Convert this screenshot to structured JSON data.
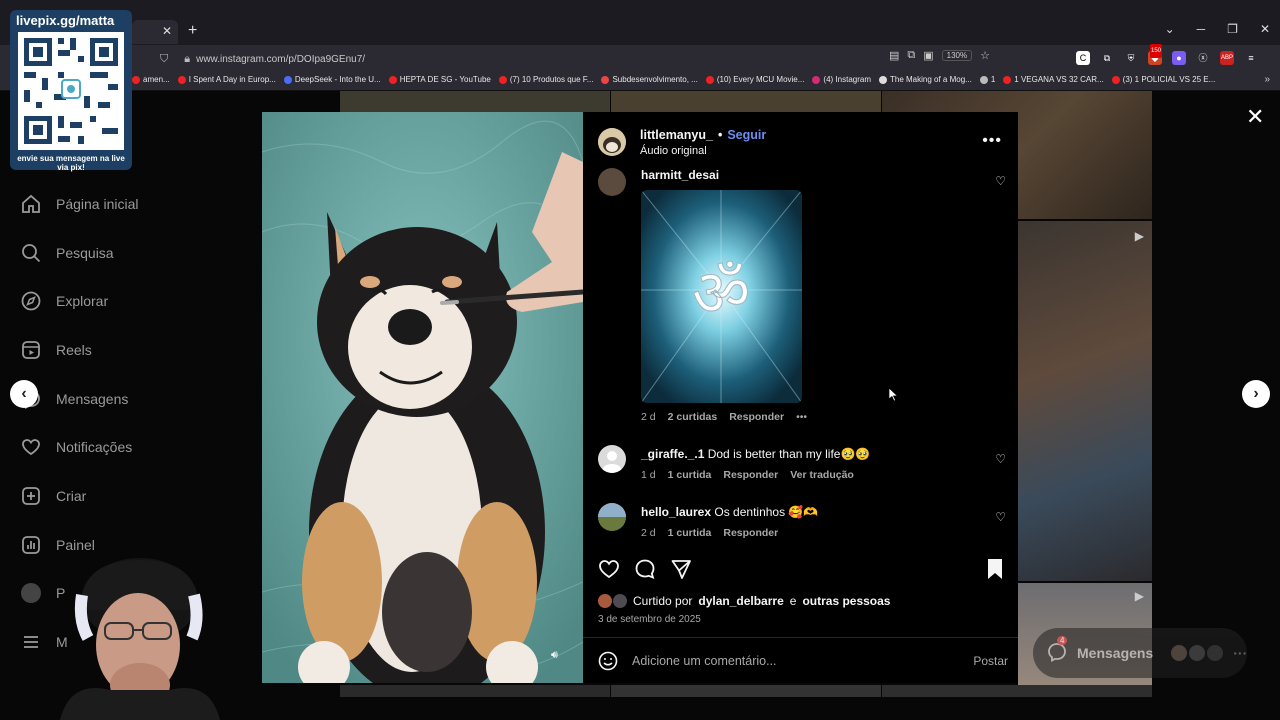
{
  "browser": {
    "url": "www.instagram.com/p/DOIpa9GEnu7/",
    "zoom": "130%",
    "bookmarks": [
      {
        "label": "amen...",
        "color": "#e22"
      },
      {
        "label": "I Spent A Day in Europ...",
        "color": "#e22"
      },
      {
        "label": "DeepSeek - Into the U...",
        "color": "#4a6cf7"
      },
      {
        "label": "HEPTA DE SG - YouTube",
        "color": "#e22"
      },
      {
        "label": "(7) 10 Produtos que F...",
        "color": "#e22"
      },
      {
        "label": "Subdesenvolvimento, ...",
        "color": "#e44"
      },
      {
        "label": "(10) Every MCU Movie...",
        "color": "#e22"
      },
      {
        "label": "(4) Instagram",
        "color": "#d62976"
      },
      {
        "label": "The Making of a Mog...",
        "color": "#ddd"
      },
      {
        "label": "1",
        "color": "#bbb"
      },
      {
        "label": "1 VEGANA VS 32 CAR...",
        "color": "#e22"
      },
      {
        "label": "(3) 1 POLICIAL VS 25 E...",
        "color": "#e22"
      }
    ],
    "ext_badge": "150"
  },
  "overlay": {
    "qr_title": "livepix.gg/matta",
    "qr_caption": "envie sua mensagem na live via pix!"
  },
  "sidebar": {
    "items": [
      {
        "label": "Página inicial",
        "icon": "home-icon"
      },
      {
        "label": "Pesquisa",
        "icon": "search-icon"
      },
      {
        "label": "Explorar",
        "icon": "compass-icon"
      },
      {
        "label": "Reels",
        "icon": "reels-icon"
      },
      {
        "label": "Mensagens",
        "icon": "messenger-icon"
      },
      {
        "label": "Notificações",
        "icon": "heart-icon"
      },
      {
        "label": "Criar",
        "icon": "plus-square-icon"
      },
      {
        "label": "Painel",
        "icon": "dashboard-icon"
      },
      {
        "label": "P",
        "icon": "profile-icon"
      },
      {
        "label": "M",
        "icon": "menu-icon"
      }
    ]
  },
  "post": {
    "username": "littlemanyu_",
    "follow": "Seguir",
    "audio": "Áudio original",
    "comments": [
      {
        "user": "harmitt_desai",
        "text": "",
        "time": "2 d",
        "likes": "2 curtidas",
        "reply": "Responder",
        "translate": ""
      },
      {
        "user": "_giraffe._.1",
        "text": "Dod is better than my life🥹🥹",
        "time": "1 d",
        "likes": "1 curtida",
        "reply": "Responder",
        "translate": "Ver tradução"
      },
      {
        "user": "hello_laurex",
        "text": "Os dentinhos 🥰🫶",
        "time": "2 d",
        "likes": "1 curtida",
        "reply": "Responder",
        "translate": ""
      }
    ],
    "liked_prefix": "Curtido por",
    "liked_user": "dylan_delbarre",
    "liked_conj": "e",
    "liked_others": "outras pessoas",
    "date": "3 de setembro de 2025",
    "comment_placeholder": "Adicione um comentário...",
    "post_button": "Postar"
  },
  "messages_pill": {
    "label": "Mensagens",
    "badge": "4"
  }
}
